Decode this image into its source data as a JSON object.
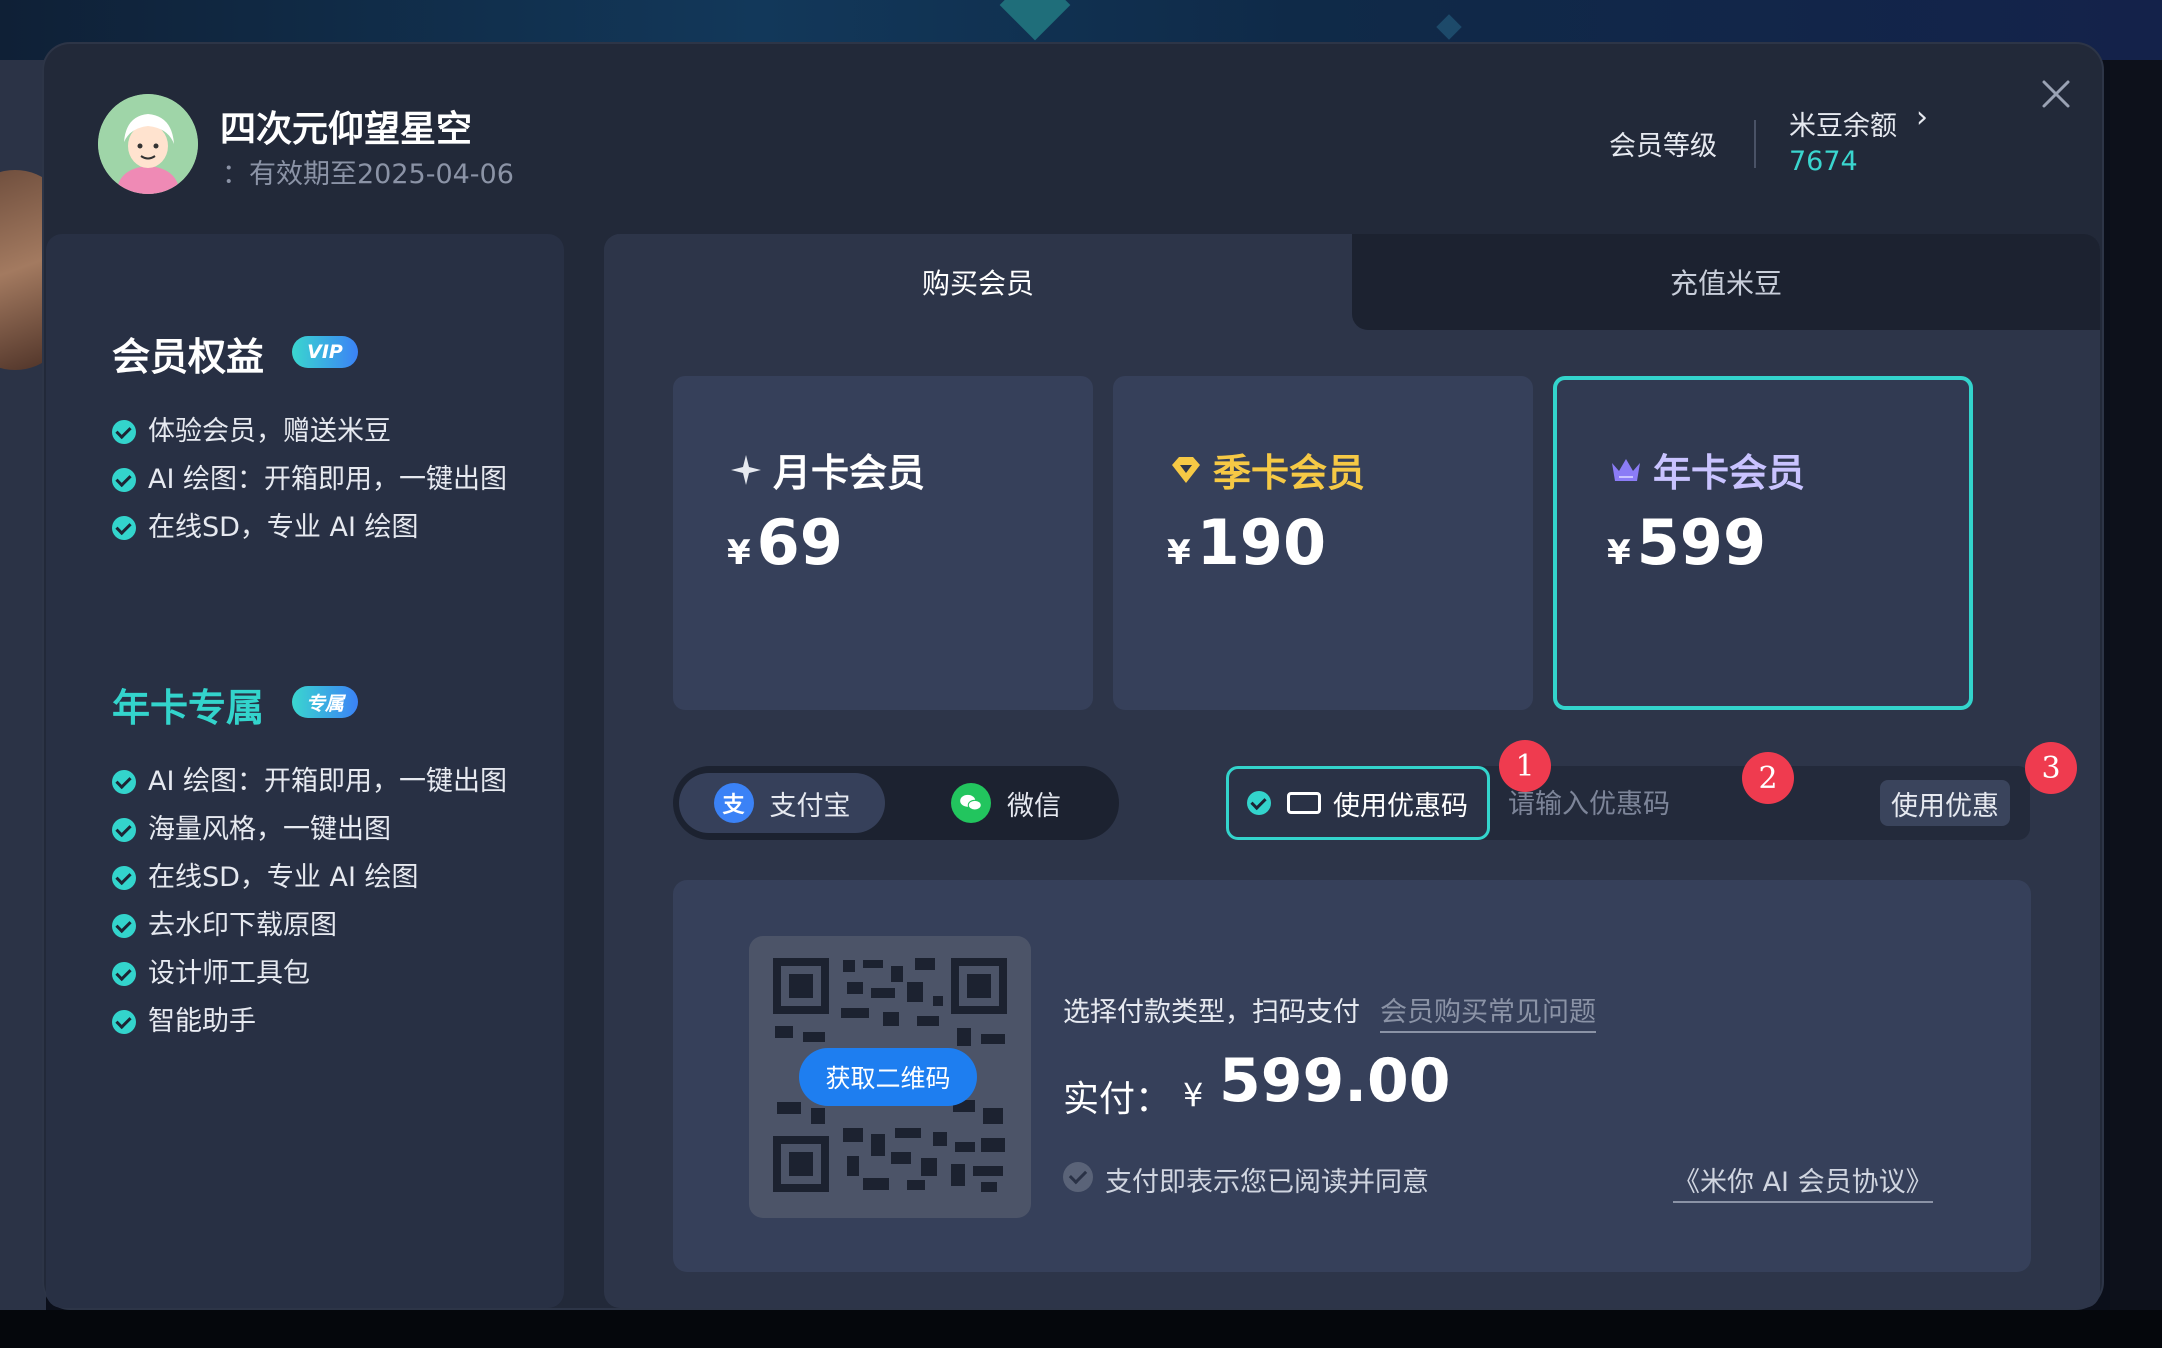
{
  "user": {
    "name": "四次元仰望星空",
    "expiry": "：有效期至2025-04-06"
  },
  "header": {
    "level_link": "会员等级",
    "balance_label": "米豆余额",
    "balance_value": "7674"
  },
  "sidebar": {
    "benefits_title": "会员权益",
    "vip_badge": "VIP",
    "benefits": [
      "体验会员，赠送米豆",
      "AI 绘图：开箱即用，一键出图",
      "在线SD，专业 AI 绘图"
    ],
    "annual_title": "年卡专属",
    "annual_badge": "专属",
    "annual_benefits": [
      "AI 绘图：开箱即用，一键出图",
      "海量风格，一键出图",
      "在线SD，专业 AI 绘图",
      "去水印下载原图",
      "设计师工具包",
      "智能助手"
    ]
  },
  "tabs": [
    {
      "label": "购买会员",
      "active": true
    },
    {
      "label": "充值米豆",
      "active": false
    }
  ],
  "plans": [
    {
      "name": "月卡会员",
      "currency": "¥",
      "price": "69",
      "icon": "sparkle-icon",
      "color": "#ffffff",
      "selected": false
    },
    {
      "name": "季卡会员",
      "currency": "¥",
      "price": "190",
      "icon": "diamond-icon",
      "color": "#f6c945",
      "selected": false
    },
    {
      "name": "年卡会员",
      "currency": "¥",
      "price": "599",
      "icon": "crown-icon",
      "color": "#c9c3ff",
      "selected": true
    }
  ],
  "payment": {
    "alipay_label": "支付宝",
    "wechat_label": "微信",
    "selected": "alipay"
  },
  "coupon": {
    "toggle_label": "使用优惠码",
    "input_placeholder": "请输入优惠码",
    "apply_label": "使用优惠",
    "markers": [
      "1",
      "2",
      "3"
    ]
  },
  "checkout": {
    "qr_button": "获取二维码",
    "hint": "选择付款类型，扫码支付",
    "faq_link": "会员购买常见问题",
    "paid_label": "实付：",
    "currency": "¥",
    "amount": "599.00",
    "agree_text": "支付即表示您已阅读并同意",
    "agreement_link": "《米你 AI 会员协议》"
  },
  "colors": {
    "accent": "#33d4cc",
    "dialog_bg": "#222939",
    "panel_bg": "#2d3549",
    "marker": "#ef3b4f",
    "qr_button": "#1e7ef0"
  }
}
